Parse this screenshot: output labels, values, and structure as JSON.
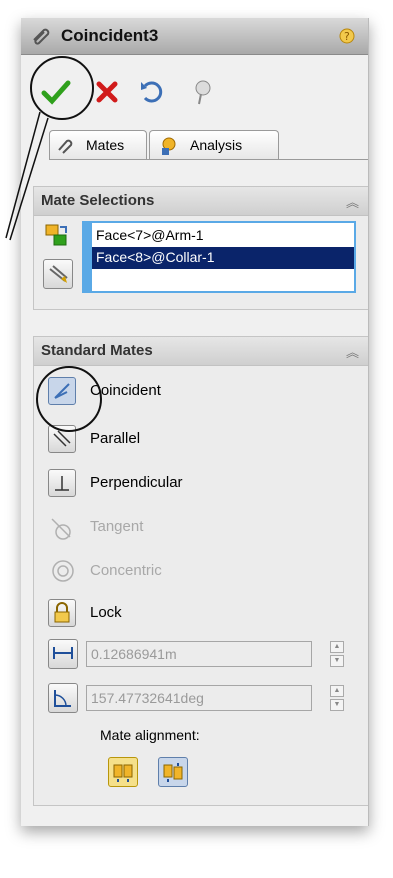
{
  "title": "Coincident3",
  "actions": {
    "ok": "ok-check-icon",
    "cancel": "cancel-x-icon",
    "undo": "undo-icon",
    "pushpin": "pushpin-icon"
  },
  "tabs": [
    {
      "label": "Mates",
      "icon": "paperclip-icon"
    },
    {
      "label": "Analysis",
      "icon": "analysis-icon"
    }
  ],
  "mate_selections": {
    "heading": "Mate Selections",
    "items": [
      "Face<7>@Arm-1",
      "Face<8>@Collar-1"
    ],
    "selected_index": 1
  },
  "standard_mates": {
    "heading": "Standard Mates",
    "items": [
      {
        "label": "Coincident",
        "icon": "coincident-icon",
        "enabled": true,
        "active": true
      },
      {
        "label": "Parallel",
        "icon": "parallel-icon",
        "enabled": true,
        "active": false
      },
      {
        "label": "Perpendicular",
        "icon": "perpendicular-icon",
        "enabled": true,
        "active": false
      },
      {
        "label": "Tangent",
        "icon": "tangent-icon",
        "enabled": false,
        "active": false
      },
      {
        "label": "Concentric",
        "icon": "concentric-icon",
        "enabled": false,
        "active": false
      },
      {
        "label": "Lock",
        "icon": "lock-icon",
        "enabled": true,
        "active": false
      }
    ],
    "distance_value": "0.12686941m",
    "angle_value": "157.47732641deg",
    "mate_alignment_label": "Mate alignment:"
  },
  "colors": {
    "selection_blue": "#0a246a",
    "list_border": "#5aa9e6",
    "ok_green": "#2fa01c",
    "cancel_red": "#d11b1b"
  }
}
